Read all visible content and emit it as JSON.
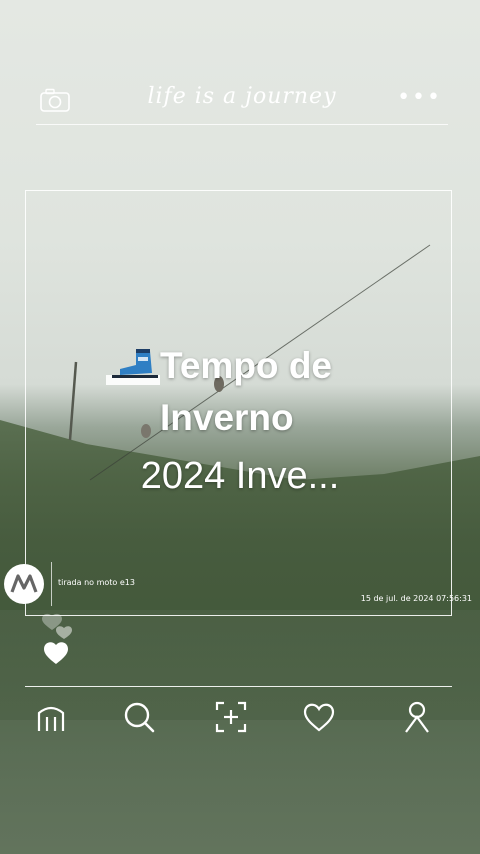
{
  "header": {
    "title": "life is a journey",
    "camera_icon": "camera-icon",
    "more_icon": "more-dots-icon",
    "more_label": "•••"
  },
  "post": {
    "headline": "Tempo de Inverno",
    "subline": "2024 Inve...",
    "emoji_icon": "ski-boot-icon",
    "caption": "tirada no moto e13",
    "timestamp": "15 de jul. de 2024 07:56:31",
    "brand_icon": "motorola-logo-icon"
  },
  "likes": {
    "icon": "heart-icon"
  },
  "nav": {
    "items": [
      {
        "name": "home",
        "icon": "home-icon"
      },
      {
        "name": "search",
        "icon": "search-icon"
      },
      {
        "name": "add",
        "icon": "add-post-icon"
      },
      {
        "name": "favorites",
        "icon": "heart-outline-icon"
      },
      {
        "name": "profile",
        "icon": "profile-icon"
      }
    ]
  },
  "colors": {
    "foreground": "#ffffff",
    "sky": "#e4e8e3",
    "grass": "#4f6544"
  }
}
